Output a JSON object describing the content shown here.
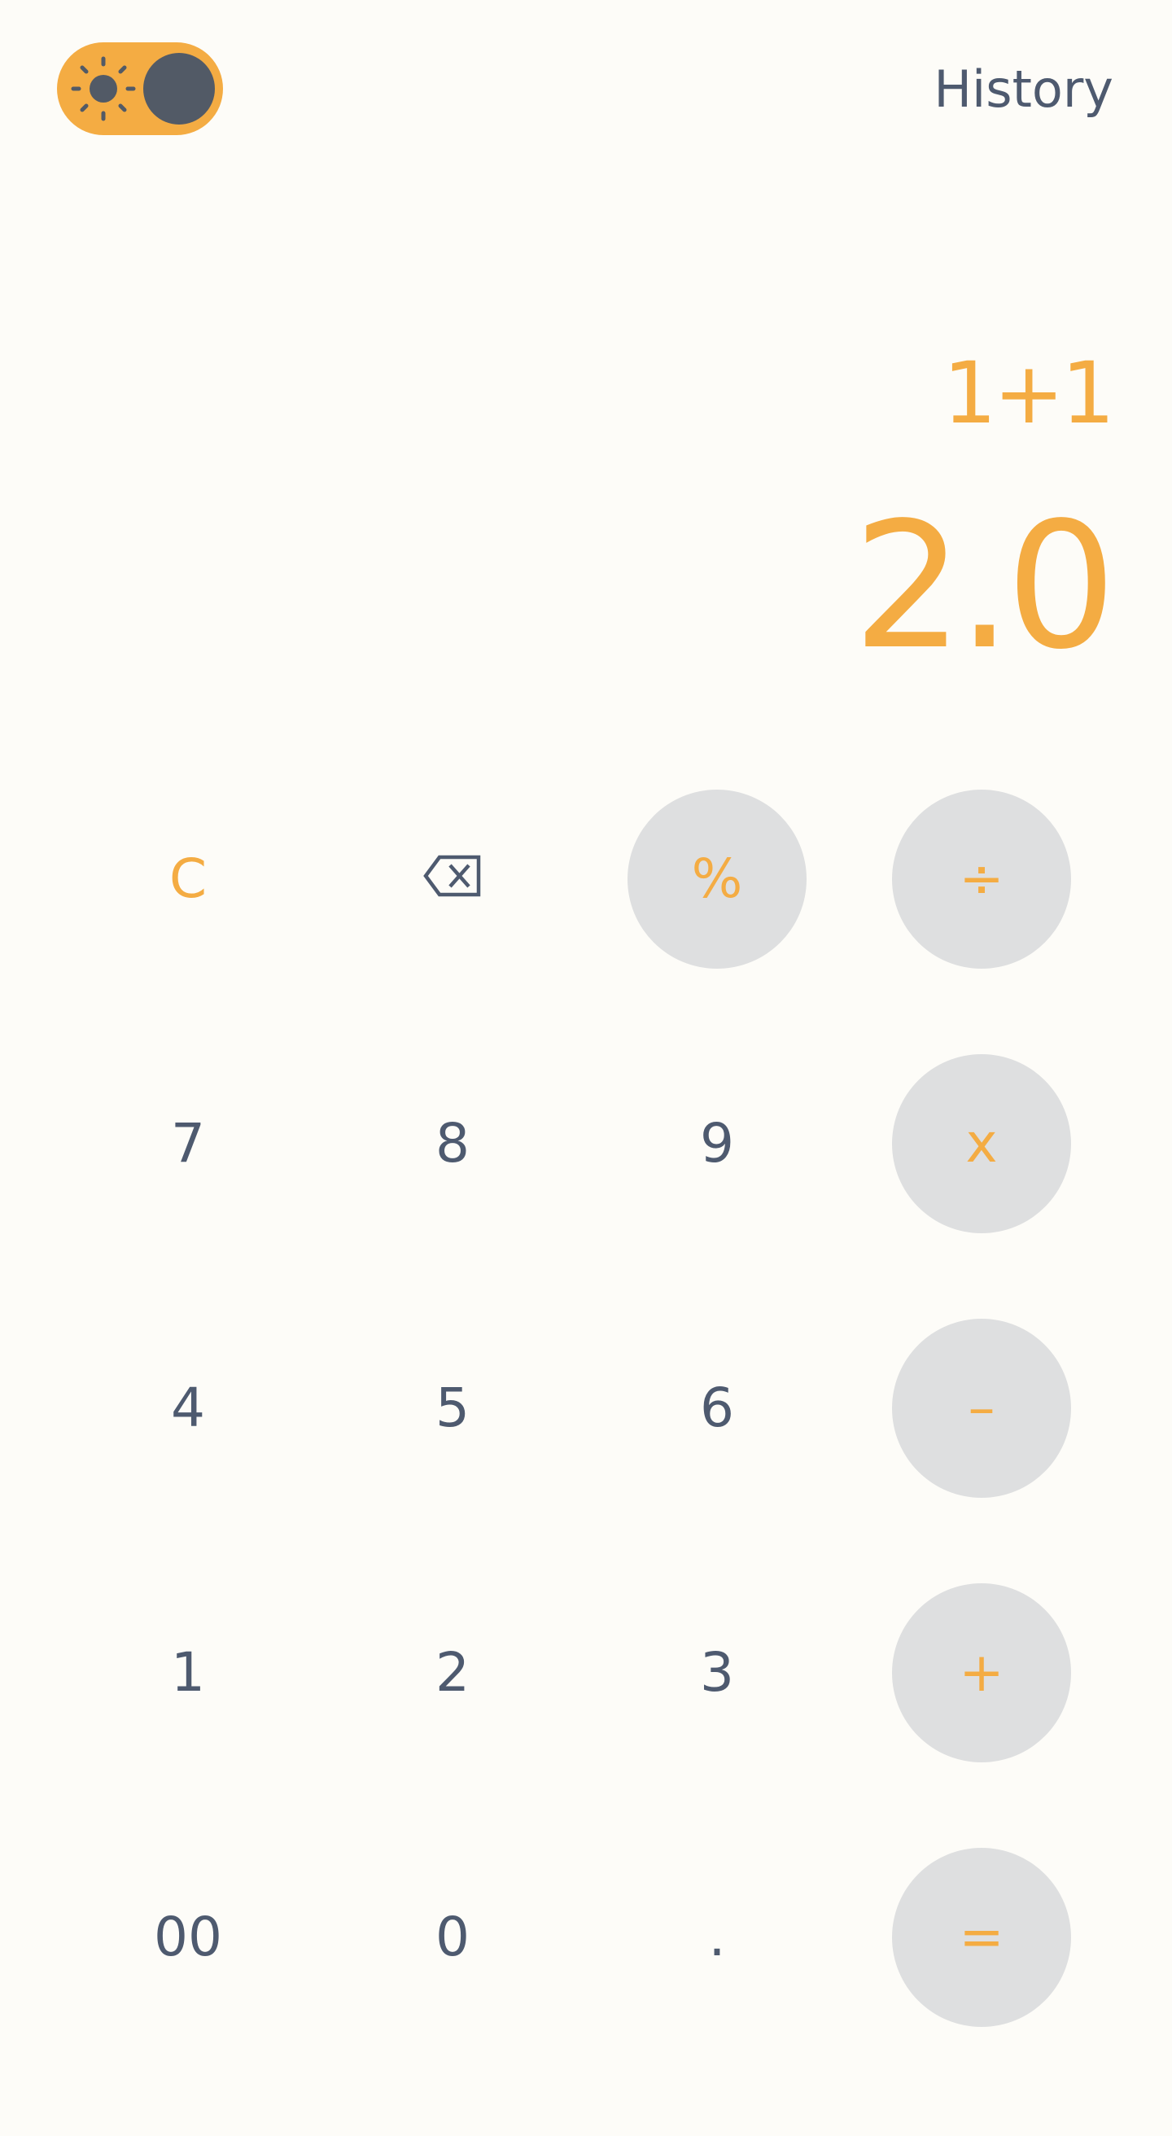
{
  "header": {
    "theme_toggle": {
      "state": "dark",
      "icon": "sun-icon"
    },
    "history_label": "History"
  },
  "display": {
    "expression": "1+1",
    "result": "2.0"
  },
  "keys": [
    {
      "id": "clear",
      "label": "C"
    },
    {
      "id": "backspace",
      "label": "",
      "icon": "backspace-icon"
    },
    {
      "id": "percent",
      "label": "%"
    },
    {
      "id": "divide",
      "label": "÷"
    },
    {
      "id": "seven",
      "label": "7"
    },
    {
      "id": "eight",
      "label": "8"
    },
    {
      "id": "nine",
      "label": "9"
    },
    {
      "id": "multiply",
      "label": "x"
    },
    {
      "id": "four",
      "label": "4"
    },
    {
      "id": "five",
      "label": "5"
    },
    {
      "id": "six",
      "label": "6"
    },
    {
      "id": "subtract",
      "label": "–"
    },
    {
      "id": "one",
      "label": "1"
    },
    {
      "id": "two",
      "label": "2"
    },
    {
      "id": "three",
      "label": "3"
    },
    {
      "id": "add",
      "label": "+"
    },
    {
      "id": "double-zero",
      "label": "00"
    },
    {
      "id": "zero",
      "label": "0"
    },
    {
      "id": "decimal",
      "label": "."
    },
    {
      "id": "equals",
      "label": "="
    }
  ],
  "colors": {
    "accent": "#f4ac43",
    "text": "#4e5a6f",
    "background": "#fdfcf8",
    "key_circle": "#dedfe0",
    "toggle_knob": "#525a66"
  }
}
